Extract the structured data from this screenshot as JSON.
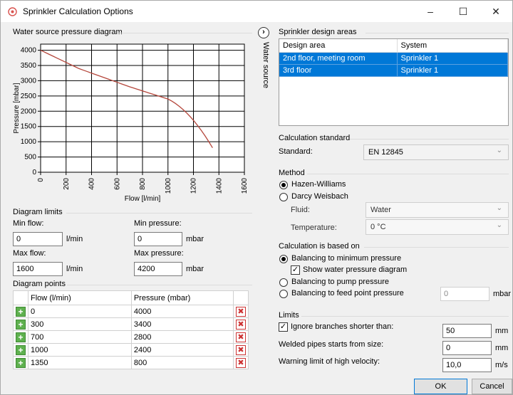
{
  "window": {
    "title": "Sprinkler Calculation Options",
    "minimize": "–",
    "maximize": "☐",
    "close": "✕"
  },
  "water_source_tab": "Water source",
  "diagram": {
    "title": "Water source pressure diagram",
    "xlabel": "Flow [l/min]",
    "ylabel": "Pressure [mbar]"
  },
  "chart_data": {
    "type": "line",
    "title": "Water source pressure diagram",
    "xlabel": "Flow [l/min]",
    "ylabel": "Pressure [mbar]",
    "xlim": [
      0,
      1600
    ],
    "ylim": [
      0,
      4200
    ],
    "xticks": [
      0,
      200,
      400,
      600,
      800,
      1000,
      1200,
      1400,
      1600
    ],
    "yticks": [
      0,
      500,
      1000,
      1500,
      2000,
      2500,
      3000,
      3500,
      4000
    ],
    "grid": true,
    "color": "#b5473c",
    "series": [
      {
        "x": [
          0,
          300,
          700,
          1000,
          1350
        ],
        "y": [
          4000,
          3400,
          2800,
          2400,
          800
        ]
      }
    ]
  },
  "limits": {
    "title": "Diagram limits",
    "min_flow_label": "Min flow:",
    "min_flow": "0",
    "min_flow_unit": "l/min",
    "min_pressure_label": "Min pressure:",
    "min_pressure": "0",
    "min_pressure_unit": "mbar",
    "max_flow_label": "Max flow:",
    "max_flow": "1600",
    "max_flow_unit": "l/min",
    "max_pressure_label": "Max pressure:",
    "max_pressure": "4200",
    "max_pressure_unit": "mbar"
  },
  "points": {
    "title": "Diagram points",
    "col_flow": "Flow (l/min)",
    "col_pressure": "Pressure (mbar)",
    "rows": [
      {
        "flow": "0",
        "pressure": "4000"
      },
      {
        "flow": "300",
        "pressure": "3400"
      },
      {
        "flow": "700",
        "pressure": "2800"
      },
      {
        "flow": "1000",
        "pressure": "2400"
      },
      {
        "flow": "1350",
        "pressure": "800"
      }
    ]
  },
  "design_areas": {
    "title": "Sprinkler design areas",
    "col_area": "Design area",
    "col_system": "System",
    "rows": [
      {
        "area": "2nd floor, meeting room",
        "system": "Sprinkler 1"
      },
      {
        "area": "3rd floor",
        "system": "Sprinkler 1"
      }
    ]
  },
  "calc_standard": {
    "title": "Calculation standard",
    "label": "Standard:",
    "value": "EN 12845"
  },
  "method": {
    "title": "Method",
    "hazen": "Hazen-Williams",
    "darcy": "Darcy Weisbach",
    "fluid_label": "Fluid:",
    "fluid_value": "Water",
    "temp_label": "Temperature:",
    "temp_value": "0 °C"
  },
  "based_on": {
    "title": "Calculation is based on",
    "min_pressure": "Balancing to minimum pressure",
    "show_diagram": "Show water pressure diagram",
    "pump_pressure": "Balancing to pump pressure",
    "feed_point": "Balancing to feed point pressure",
    "feed_value": "0",
    "feed_unit": "mbar"
  },
  "limits_right": {
    "title": "Limits",
    "ignore_label": "Ignore branches shorter than:",
    "ignore_value": "50",
    "ignore_unit": "mm",
    "welded_label": "Welded pipes starts from size:",
    "welded_value": "0",
    "welded_unit": "mm",
    "velocity_label": "Warning limit of high velocity:",
    "velocity_value": "10,0",
    "velocity_unit": "m/s"
  },
  "buttons": {
    "ok": "OK",
    "cancel": "Cancel"
  }
}
